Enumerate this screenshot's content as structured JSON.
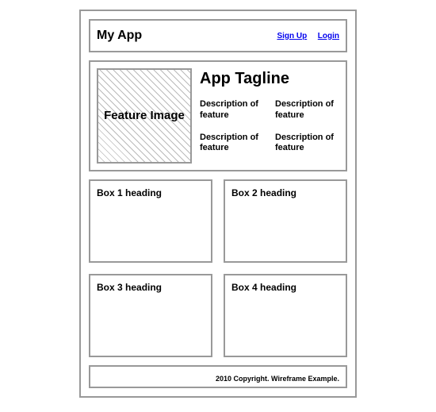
{
  "header": {
    "app_title": "My App",
    "signup_label": "Sign Up",
    "login_label": "Login"
  },
  "featured": {
    "image_label": "Feature Image",
    "tagline": "App Tagline",
    "descriptions": [
      "Description of feature",
      "Description of feature",
      "Description of feature",
      "Description of feature"
    ]
  },
  "boxes": [
    {
      "heading": "Box 1 heading"
    },
    {
      "heading": "Box 2 heading"
    },
    {
      "heading": "Box 3 heading"
    },
    {
      "heading": "Box 4 heading"
    }
  ],
  "footer": {
    "text": "2010 Copyright. Wireframe Example."
  }
}
